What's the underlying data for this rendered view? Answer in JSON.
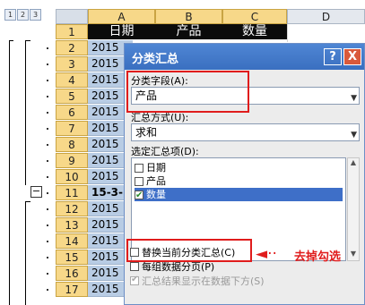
{
  "outline": {
    "level_buttons": [
      "1",
      "2",
      "3"
    ],
    "collapse_symbol": "−"
  },
  "sheet": {
    "columns": [
      "A",
      "B",
      "C",
      "D"
    ],
    "header_row": {
      "row": "1",
      "cells": [
        "日期",
        "产品",
        "数量"
      ]
    },
    "rows": [
      {
        "num": "2",
        "a": "2015"
      },
      {
        "num": "3",
        "a": "2015"
      },
      {
        "num": "4",
        "a": "2015"
      },
      {
        "num": "5",
        "a": "2015"
      },
      {
        "num": "6",
        "a": "2015"
      },
      {
        "num": "7",
        "a": "2015"
      },
      {
        "num": "8",
        "a": "2015"
      },
      {
        "num": "9",
        "a": "2015"
      },
      {
        "num": "10",
        "a": "2015"
      },
      {
        "num": "11",
        "a": "15-3-"
      },
      {
        "num": "12",
        "a": "2015"
      },
      {
        "num": "13",
        "a": "2015"
      },
      {
        "num": "14",
        "a": "2015"
      },
      {
        "num": "15",
        "a": "2015"
      },
      {
        "num": "16",
        "a": "2015"
      },
      {
        "num": "17",
        "a": "2015"
      }
    ]
  },
  "dialog": {
    "title": "分类汇总",
    "help_button": "?",
    "close_button": "X",
    "group_field_label": "分类字段(A):",
    "group_field_value": "产品",
    "summary_label": "汇总方式(U):",
    "summary_value": "求和",
    "items_label": "选定汇总项(D):",
    "items": [
      {
        "label": "日期",
        "checked": false,
        "selected": false
      },
      {
        "label": "产品",
        "checked": false,
        "selected": false
      },
      {
        "label": "数量",
        "checked": true,
        "selected": true
      }
    ],
    "options": [
      {
        "label": "替换当前分类汇总(C)",
        "checked": false,
        "disabled": false
      },
      {
        "label": "每组数据分页(P)",
        "checked": false,
        "disabled": false
      },
      {
        "label": "汇总结果显示在数据下方(S)",
        "checked": true,
        "disabled": true
      }
    ]
  },
  "annotation": {
    "text": "去掉勾选",
    "color": "#e01c1c"
  },
  "colors": {
    "selection_blue": "#b8cce4",
    "header_row": "#0b0b0b",
    "row_header": "#f7d889",
    "title_bar": "#3a6fc0"
  }
}
